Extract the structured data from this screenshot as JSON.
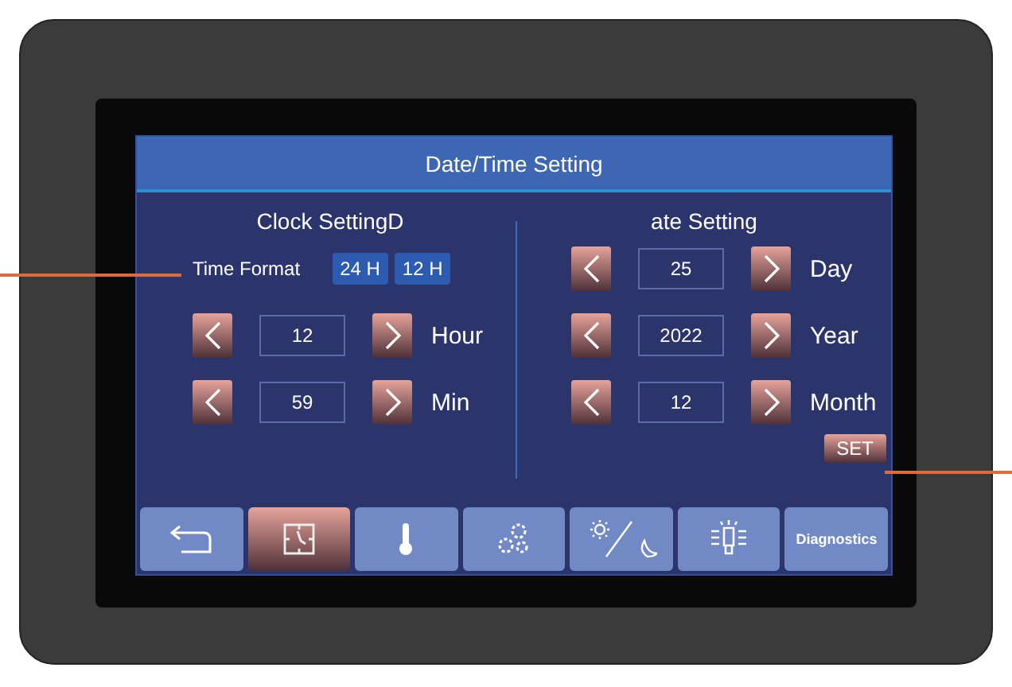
{
  "window": {
    "title": "Date/Time Setting"
  },
  "clock_setting": {
    "title": "Clock SettingD",
    "time_format": {
      "label": "Time Format",
      "options": [
        {
          "label": "24 H"
        },
        {
          "label": "12 H"
        }
      ]
    },
    "spinners": [
      {
        "value": "12",
        "label": "Hour"
      },
      {
        "value": "59",
        "label": "Min"
      }
    ]
  },
  "date_setting": {
    "title": "ate Setting",
    "spinners": [
      {
        "value": "25",
        "label": "Day"
      },
      {
        "value": "2022",
        "label": "Year"
      },
      {
        "value": "12",
        "label": "Month"
      }
    ]
  },
  "set_button": "SET",
  "nav": [
    {
      "kind": "back",
      "selected": false
    },
    {
      "kind": "clock",
      "selected": true
    },
    {
      "kind": "thermometer",
      "selected": false
    },
    {
      "kind": "gears",
      "selected": false
    },
    {
      "kind": "daynight",
      "selected": false
    },
    {
      "kind": "bulb",
      "selected": false
    },
    {
      "kind": "text",
      "label": "Diagnostics",
      "selected": false
    }
  ]
}
